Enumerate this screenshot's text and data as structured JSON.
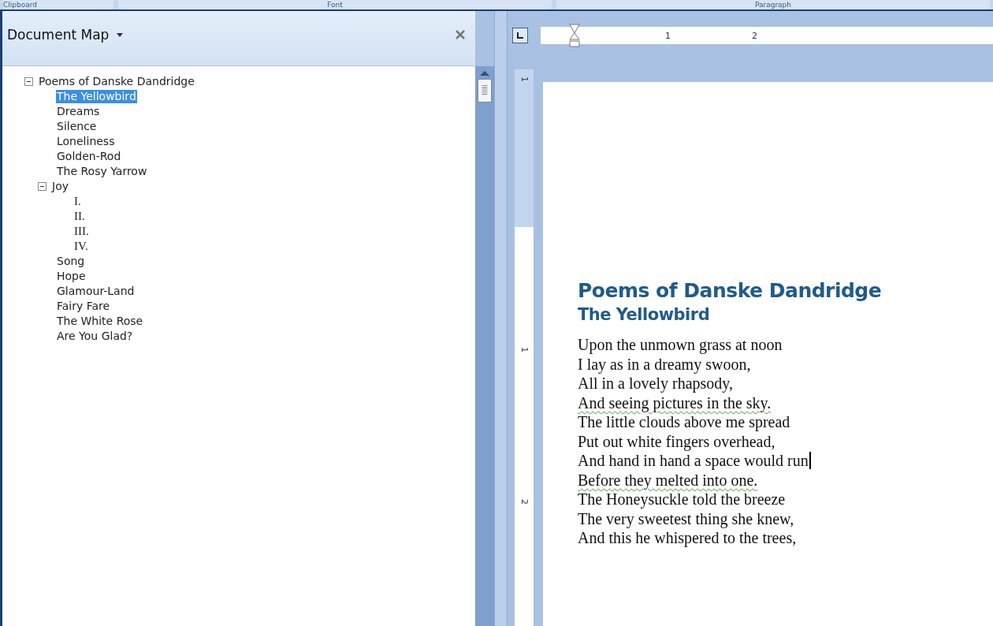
{
  "ribbon_groups": [
    "Clipboard",
    "Font",
    "Paragraph"
  ],
  "document_map": {
    "title": "Document Map",
    "tree": [
      {
        "label": "Poems of Danske Dandridge",
        "expanded": true,
        "selected": false,
        "children": [
          {
            "label": "The Yellowbird",
            "selected": true
          },
          {
            "label": "Dreams",
            "selected": false
          },
          {
            "label": "Silence",
            "selected": false
          },
          {
            "label": "Loneliness",
            "selected": false
          },
          {
            "label": "Golden-Rod",
            "selected": false
          },
          {
            "label": "The Rosy Yarrow",
            "selected": false
          },
          {
            "label": "Joy",
            "expanded": true,
            "selected": false,
            "children": [
              {
                "label": "I.",
                "selected": false
              },
              {
                "label": "II.",
                "selected": false
              },
              {
                "label": "III.",
                "selected": false
              },
              {
                "label": "IV.",
                "selected": false
              }
            ]
          },
          {
            "label": "Song",
            "selected": false
          },
          {
            "label": "Hope",
            "selected": false
          },
          {
            "label": "Glamour-Land",
            "selected": false
          },
          {
            "label": "Fairy Fare",
            "selected": false
          },
          {
            "label": "The White Rose",
            "selected": false
          },
          {
            "label": "Are You Glad?",
            "selected": false
          }
        ]
      }
    ]
  },
  "rulers": {
    "horizontal": [
      "1",
      "2"
    ],
    "vertical": [
      "1",
      "1",
      "2"
    ]
  },
  "document": {
    "title": "Poems of Danske Dandridge",
    "heading": "The Yellowbird",
    "lines": [
      {
        "text": "Upon the unmown grass at noon",
        "grammar_flag": false,
        "cursor": false
      },
      {
        "text": "I lay as in a dreamy swoon,",
        "grammar_flag": false,
        "cursor": false
      },
      {
        "text": "All in a lovely rhapsody,",
        "grammar_flag": false,
        "cursor": false
      },
      {
        "text": "And seeing pictures in the sky.",
        "grammar_flag": true,
        "cursor": false
      },
      {
        "text": "The little clouds above me spread",
        "grammar_flag": false,
        "cursor": false
      },
      {
        "text": "Put out white fingers overhead,",
        "grammar_flag": false,
        "cursor": false
      },
      {
        "text": "And hand in hand a space would run",
        "grammar_flag": false,
        "cursor": true
      },
      {
        "text": "Before they melted into one.",
        "grammar_flag": true,
        "cursor": false
      },
      {
        "text": "The Honeysuckle told the breeze",
        "grammar_flag": false,
        "cursor": false
      },
      {
        "text": "The very sweetest thing she knew,",
        "grammar_flag": false,
        "cursor": false
      },
      {
        "text": "And this he whispered to the trees,",
        "grammar_flag": false,
        "cursor": false
      }
    ]
  }
}
